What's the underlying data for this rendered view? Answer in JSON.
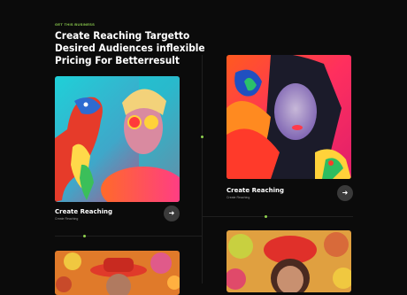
{
  "section": {
    "kicker": "GET THIS BUSINESS",
    "title": "Create Reaching Targetto Desired Audiences inflexible Pricing For Betterresult"
  },
  "cards": [
    {
      "title": "Create Reaching",
      "subtitle": "Create Reaching",
      "image": "man-with-parrot-neon",
      "arrow_icon": "arrow-right-icon"
    },
    {
      "title": "Create Reaching",
      "subtitle": "Create Reaching",
      "image": "woman-with-parrot-feathers",
      "arrow_icon": "arrow-right-icon"
    },
    {
      "title": "",
      "subtitle": "",
      "image": "man-with-hat-flowers",
      "arrow_icon": ""
    },
    {
      "title": "",
      "subtitle": "",
      "image": "woman-with-red-beret",
      "arrow_icon": ""
    }
  ],
  "colors": {
    "accent": "#8fd14f",
    "background": "#0b0b0b",
    "button": "#3a3a3a"
  }
}
